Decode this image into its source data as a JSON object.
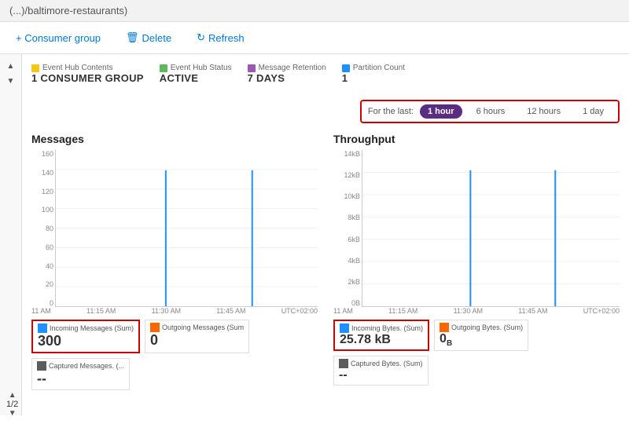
{
  "titleBar": {
    "text": "(...)/baltimore-restaurants)"
  },
  "toolbar": {
    "consumerGroupLabel": "+ Consumer group",
    "deleteLabel": "Delete",
    "refreshLabel": "Refresh"
  },
  "metrics": [
    {
      "id": "hub-contents",
      "color": "#f5c518",
      "label": "Event Hub Contents",
      "value": "1 CONSUMER GROUP"
    },
    {
      "id": "hub-status",
      "color": "#5cb85c",
      "label": "Event Hub Status",
      "value": "ACTIVE"
    },
    {
      "id": "retention",
      "color": "#9b59b6",
      "label": "Message Retention",
      "value": "7 DAYS"
    },
    {
      "id": "partition",
      "color": "#1e90ff",
      "label": "Partition Count",
      "value": "1"
    }
  ],
  "timeFilter": {
    "label": "For the last:",
    "options": [
      {
        "value": "1 hour",
        "active": true
      },
      {
        "value": "6 hours",
        "active": false
      },
      {
        "value": "12 hours",
        "active": false
      },
      {
        "value": "1 day",
        "active": false
      }
    ]
  },
  "messagesChart": {
    "title": "Messages",
    "yLabels": [
      "160",
      "140",
      "120",
      "100",
      "80",
      "60",
      "40",
      "20",
      "0"
    ],
    "xLabels": [
      "11 AM",
      "11:15 AM",
      "11:30 AM",
      "11:45 AM",
      "UTC+02:00"
    ],
    "spike1X": 42,
    "spike2X": 75
  },
  "throughputChart": {
    "title": "Throughput",
    "yLabels": [
      "14kB",
      "12kB",
      "10kB",
      "8kB",
      "6kB",
      "4kB",
      "2kB",
      "0B"
    ],
    "xLabels": [
      "11 AM",
      "11:15 AM",
      "11:30 AM",
      "11:45 AM",
      "UTC+02:00"
    ],
    "spike1X": 42,
    "spike2X": 75
  },
  "messagesLegend": [
    {
      "color": "#1e90ff",
      "label": "Incoming Messages (Sum)",
      "value": "300",
      "highlighted": true
    },
    {
      "color": "#ff6600",
      "label": "Outgoing Messages (Sum",
      "value": "0",
      "highlighted": false
    },
    {
      "color": "#5c5c5c",
      "label": "Captured Messages. (...",
      "value": "--",
      "highlighted": false
    }
  ],
  "throughputLegend": [
    {
      "color": "#1e90ff",
      "label": "Incoming Bytes. (Sum)",
      "value": "25.78 kB",
      "highlighted": true
    },
    {
      "color": "#ff6600",
      "label": "Outgoing Bytes. (Sum)",
      "value": "0B",
      "highlighted": false
    },
    {
      "color": "#5c5c5c",
      "label": "Captured Bytes. (Sum)",
      "value": "--",
      "highlighted": false
    }
  ],
  "pagination": {
    "current": "1",
    "total": "2"
  }
}
